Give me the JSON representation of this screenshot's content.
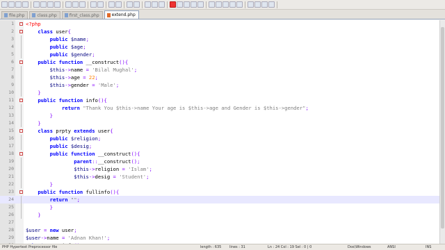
{
  "tabs": [
    {
      "label": "file.php",
      "active": false
    },
    {
      "label": "class.php",
      "active": false
    },
    {
      "label": "first_class.php",
      "active": false
    },
    {
      "label": "extend.php",
      "active": true
    }
  ],
  "colors": {
    "keyword": "#0000ff",
    "variable": "#000080",
    "string": "#808080",
    "number": "#ff8000",
    "operator": "#8000ff",
    "php_tag": "#ff0000",
    "current_line": "#e8e8ff"
  },
  "current_line": 24,
  "lines": [
    [
      {
        "t": "<?php",
        "c": "t"
      }
    ],
    [
      {
        "t": "    "
      },
      {
        "t": "class",
        "c": "k"
      },
      {
        "t": " user"
      },
      {
        "t": "{",
        "c": "o"
      }
    ],
    [
      {
        "t": "        "
      },
      {
        "t": "public",
        "c": "k"
      },
      {
        "t": " "
      },
      {
        "t": "$name",
        "c": "v"
      },
      {
        "t": ";",
        "c": "o"
      }
    ],
    [
      {
        "t": "        "
      },
      {
        "t": "public",
        "c": "k"
      },
      {
        "t": " "
      },
      {
        "t": "$age",
        "c": "v"
      },
      {
        "t": ";",
        "c": "o"
      }
    ],
    [
      {
        "t": "        "
      },
      {
        "t": "public",
        "c": "k"
      },
      {
        "t": " "
      },
      {
        "t": "$gender",
        "c": "v"
      },
      {
        "t": ";",
        "c": "o"
      }
    ],
    [
      {
        "t": "    "
      },
      {
        "t": "public",
        "c": "k"
      },
      {
        "t": " "
      },
      {
        "t": "function",
        "c": "k"
      },
      {
        "t": " __construct"
      },
      {
        "t": "(){",
        "c": "o"
      }
    ],
    [
      {
        "t": "        "
      },
      {
        "t": "$this",
        "c": "v"
      },
      {
        "t": "->",
        "c": "o"
      },
      {
        "t": "name "
      },
      {
        "t": "=",
        "c": "o"
      },
      {
        "t": " "
      },
      {
        "t": "'Bilal Mughal'",
        "c": "s"
      },
      {
        "t": ";",
        "c": "o"
      }
    ],
    [
      {
        "t": "        "
      },
      {
        "t": "$this",
        "c": "v"
      },
      {
        "t": "->",
        "c": "o"
      },
      {
        "t": "age "
      },
      {
        "t": "=",
        "c": "o"
      },
      {
        "t": " "
      },
      {
        "t": "22",
        "c": "n"
      },
      {
        "t": ";",
        "c": "o"
      }
    ],
    [
      {
        "t": "        "
      },
      {
        "t": "$this",
        "c": "v"
      },
      {
        "t": "->",
        "c": "o"
      },
      {
        "t": "gender "
      },
      {
        "t": "=",
        "c": "o"
      },
      {
        "t": " "
      },
      {
        "t": "'Male'",
        "c": "s"
      },
      {
        "t": ";",
        "c": "o"
      }
    ],
    [
      {
        "t": "    "
      },
      {
        "t": "}",
        "c": "o"
      }
    ],
    [
      {
        "t": "    "
      },
      {
        "t": "public",
        "c": "k"
      },
      {
        "t": " "
      },
      {
        "t": "function",
        "c": "k"
      },
      {
        "t": " info"
      },
      {
        "t": "(){",
        "c": "o"
      }
    ],
    [
      {
        "t": "            "
      },
      {
        "t": "return",
        "c": "k"
      },
      {
        "t": " "
      },
      {
        "t": "\"Thank You $this->name Your age is $this->age and Gender is $this->gender\"",
        "c": "s"
      },
      {
        "t": ";",
        "c": "o"
      }
    ],
    [
      {
        "t": "        "
      },
      {
        "t": "}",
        "c": "o"
      }
    ],
    [
      {
        "t": "    "
      },
      {
        "t": "}",
        "c": "o"
      }
    ],
    [
      {
        "t": "    "
      },
      {
        "t": "class",
        "c": "k"
      },
      {
        "t": " prpty "
      },
      {
        "t": "extends",
        "c": "k"
      },
      {
        "t": " user"
      },
      {
        "t": "{",
        "c": "o"
      }
    ],
    [
      {
        "t": "        "
      },
      {
        "t": "public",
        "c": "k"
      },
      {
        "t": " "
      },
      {
        "t": "$religion",
        "c": "v"
      },
      {
        "t": ";",
        "c": "o"
      }
    ],
    [
      {
        "t": "        "
      },
      {
        "t": "public",
        "c": "k"
      },
      {
        "t": " "
      },
      {
        "t": "$desig",
        "c": "v"
      },
      {
        "t": ";",
        "c": "o"
      }
    ],
    [
      {
        "t": "        "
      },
      {
        "t": "public",
        "c": "k"
      },
      {
        "t": " "
      },
      {
        "t": "function",
        "c": "k"
      },
      {
        "t": " __construct"
      },
      {
        "t": "(){",
        "c": "o"
      }
    ],
    [
      {
        "t": "                "
      },
      {
        "t": "parent",
        "c": "k"
      },
      {
        "t": "::",
        "c": "o"
      },
      {
        "t": "__construct"
      },
      {
        "t": "();",
        "c": "o"
      }
    ],
    [
      {
        "t": "                "
      },
      {
        "t": "$this",
        "c": "v"
      },
      {
        "t": "->",
        "c": "o"
      },
      {
        "t": "religion "
      },
      {
        "t": "=",
        "c": "o"
      },
      {
        "t": " "
      },
      {
        "t": "'Islam'",
        "c": "s"
      },
      {
        "t": ";",
        "c": "o"
      }
    ],
    [
      {
        "t": "                "
      },
      {
        "t": "$this",
        "c": "v"
      },
      {
        "t": "->",
        "c": "o"
      },
      {
        "t": "desig "
      },
      {
        "t": "=",
        "c": "o"
      },
      {
        "t": " "
      },
      {
        "t": "'Student'",
        "c": "s"
      },
      {
        "t": ";",
        "c": "o"
      }
    ],
    [
      {
        "t": "        "
      },
      {
        "t": "}",
        "c": "o"
      }
    ],
    [
      {
        "t": "    "
      },
      {
        "t": "public",
        "c": "k"
      },
      {
        "t": " "
      },
      {
        "t": "function",
        "c": "k"
      },
      {
        "t": " fullinfo"
      },
      {
        "t": "(){",
        "c": "o"
      }
    ],
    [
      {
        "t": "        "
      },
      {
        "t": "return",
        "c": "k"
      },
      {
        "t": " "
      },
      {
        "t": "\"\"",
        "c": "s"
      },
      {
        "t": ";",
        "c": "o"
      }
    ],
    [
      {
        "t": "        "
      },
      {
        "t": "}",
        "c": "o"
      }
    ],
    [
      {
        "t": "    "
      },
      {
        "t": "}",
        "c": "o"
      }
    ],
    [
      {
        "t": ""
      }
    ],
    [
      {
        "t": "$user",
        "c": "v"
      },
      {
        "t": " "
      },
      {
        "t": "=",
        "c": "o"
      },
      {
        "t": " "
      },
      {
        "t": "new",
        "c": "k"
      },
      {
        "t": " user"
      },
      {
        "t": ";",
        "c": "o"
      }
    ],
    [
      {
        "t": "$user",
        "c": "v"
      },
      {
        "t": "->",
        "c": "o"
      },
      {
        "t": "name "
      },
      {
        "t": "=",
        "c": "o"
      },
      {
        "t": " "
      },
      {
        "t": "'Adnan Khan!'",
        "c": "s"
      },
      {
        "t": ";",
        "c": "o"
      }
    ],
    [
      {
        "t": "echo",
        "c": "k"
      },
      {
        "t": " "
      },
      {
        "t": "$user",
        "c": "v"
      },
      {
        "t": "->",
        "c": "o"
      },
      {
        "t": "info"
      },
      {
        "t": "();",
        "c": "o"
      }
    ]
  ],
  "fold_markers": [
    1,
    2,
    6,
    11,
    15,
    18,
    23
  ],
  "status": {
    "file_type": "PHP Hypertext Preprocessor file",
    "length": "length : 635",
    "lines": "lines : 31",
    "position": "Ln : 24    Col : 19    Sel : 0 | 0",
    "eol": "Dos\\Windows",
    "encoding": "ANSI",
    "mode": "INS"
  }
}
